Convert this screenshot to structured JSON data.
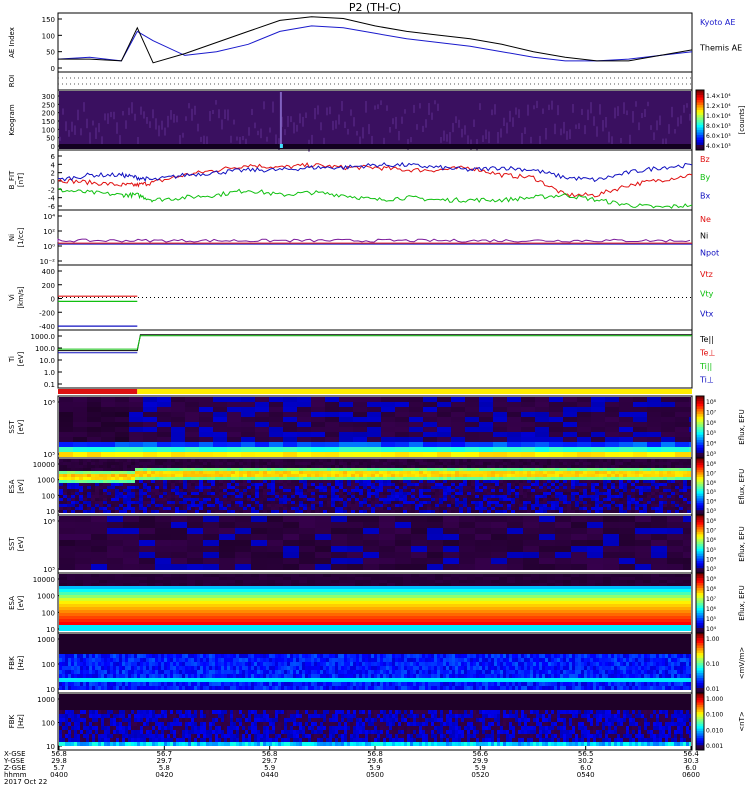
{
  "title": "P2 (TH-C)",
  "colors": {
    "kyoto": "#1a1acc",
    "themis": "#000000",
    "red": "#e01010",
    "green": "#10c010",
    "blue": "#1010c0",
    "purple": "#7a1a9a",
    "bar_red": "#dd1111",
    "bar_yellow": "#ffee00"
  },
  "panels": [
    {
      "key": "ae",
      "ylabel": "AE Index",
      "unit": "",
      "yticks": [
        "150",
        "100",
        "50",
        "0"
      ],
      "legend": [
        {
          "text": "Kyoto AE",
          "color": "#1a1acc"
        },
        {
          "text": "Themis AE",
          "color": "#000000"
        }
      ]
    },
    {
      "key": "roi",
      "ylabel": "ROI",
      "unit": "",
      "yticks": [],
      "legend": []
    },
    {
      "key": "keogram",
      "ylabel": "Keogram",
      "unit": "",
      "yticks": [
        "300",
        "250",
        "200",
        "150",
        "100",
        "50",
        "0"
      ],
      "legend": []
    },
    {
      "key": "bfield",
      "ylabel": "B_FIT",
      "unit": "[nT]",
      "yticks": [
        "6",
        "4",
        "2",
        "0",
        "-2",
        "-4",
        "-6"
      ],
      "legend": [
        {
          "text": "Bz",
          "color": "#e01010"
        },
        {
          "text": "By",
          "color": "#10c010"
        },
        {
          "text": "Bx",
          "color": "#1010c0"
        }
      ]
    },
    {
      "key": "density",
      "ylabel": "Ni",
      "unit": "[1/cc]",
      "yticks": [
        "10⁴",
        "10²",
        "10⁰",
        "10⁻²"
      ],
      "legend": [
        {
          "text": "Ne",
          "color": "#e01010"
        },
        {
          "text": "Ni",
          "color": "#000000"
        },
        {
          "text": "Npot",
          "color": "#1010c0"
        }
      ]
    },
    {
      "key": "velocity",
      "ylabel": "Vi",
      "unit": "[km/s]",
      "yticks": [
        "400",
        "200",
        "0",
        "-200",
        "-400"
      ],
      "legend": [
        {
          "text": "Vtz",
          "color": "#e01010"
        },
        {
          "text": "Vty",
          "color": "#10c010"
        },
        {
          "text": "Vtx",
          "color": "#1010c0"
        }
      ]
    },
    {
      "key": "temperature",
      "ylabel": "Ti",
      "unit": "[eV]",
      "yticks": [
        "1000.0",
        "100.0",
        "10.0",
        "1.0",
        "0.1"
      ],
      "legend": [
        {
          "text": "Te||",
          "color": "#000000"
        },
        {
          "text": "Te⊥",
          "color": "#e01010"
        },
        {
          "text": "Ti||",
          "color": "#10c010"
        },
        {
          "text": "Ti⊥",
          "color": "#1010c0"
        }
      ]
    },
    {
      "key": "sst_ion",
      "ylabel": "SST",
      "unit": "[eV]",
      "yticks": [
        "10⁶",
        "10⁵"
      ],
      "legend": []
    },
    {
      "key": "esa_ion",
      "ylabel": "ESA",
      "unit": "[eV]",
      "yticks": [
        "10000",
        "1000",
        "100",
        "10"
      ],
      "legend": []
    },
    {
      "key": "sst_elec",
      "ylabel": "SST",
      "unit": "[eV]",
      "yticks": [
        "10⁶",
        "10⁵"
      ],
      "legend": []
    },
    {
      "key": "esa_elec",
      "ylabel": "ESA",
      "unit": "[eV]",
      "yticks": [
        "10000",
        "1000",
        "100",
        "10"
      ],
      "legend": []
    },
    {
      "key": "fbk_e",
      "ylabel": "FBK",
      "unit": "[Hz]",
      "yticks": [
        "1000",
        "100",
        "10"
      ],
      "legend": []
    },
    {
      "key": "fbk_b",
      "ylabel": "FBK",
      "unit": "[Hz]",
      "yticks": [
        "1000",
        "100",
        "10"
      ],
      "legend": []
    }
  ],
  "colorbars": [
    {
      "key": "keogram",
      "label": "[counts]",
      "ticks": [
        "1.4×10⁴",
        "1.2×10⁴",
        "1.0×10⁴",
        "8.0×10³",
        "6.0×10³",
        "4.0×10³"
      ]
    },
    {
      "key": "sst_ion",
      "label": "Eflux, EFU",
      "ticks": [
        "10⁸",
        "10⁷",
        "10⁶",
        "10⁵",
        "10⁴",
        "10³"
      ]
    },
    {
      "key": "esa_ion",
      "label": "Eflux, EFU",
      "ticks": [
        "10⁸",
        "10⁷",
        "10⁶",
        "10⁵",
        "10⁴",
        "10³"
      ]
    },
    {
      "key": "sst_elec",
      "label": "Eflux, EFU",
      "ticks": [
        "10⁸",
        "10⁷",
        "10⁶",
        "10⁵",
        "10⁴",
        "10³"
      ]
    },
    {
      "key": "esa_elec",
      "label": "Eflux, EFU",
      "ticks": [
        "10⁹",
        "10⁸",
        "10⁷",
        "10⁶",
        "10⁵",
        "10⁴"
      ]
    },
    {
      "key": "fbk",
      "label": "<mV/m>",
      "ticks": [
        "1.00",
        "0.10",
        "0.01"
      ]
    },
    {
      "key": "fbk2",
      "label": "<nT>",
      "ticks": [
        "1.000",
        "0.100",
        "0.010",
        "0.001"
      ]
    }
  ],
  "time_axis": {
    "row_labels": [
      "X-GSE",
      "Y-GSE",
      "Z-GSE",
      "hhmm",
      "2017 Oct 22"
    ],
    "ticks": [
      {
        "x": "56.8",
        "y": "29.8",
        "z": "5.7",
        "t": "0400"
      },
      {
        "x": "56.7",
        "y": "29.7",
        "z": "5.8",
        "t": "0420"
      },
      {
        "x": "56.8",
        "y": "29.7",
        "z": "5.9",
        "t": "0440"
      },
      {
        "x": "56.8",
        "y": "29.6",
        "z": "5.9",
        "t": "0500"
      },
      {
        "x": "56.6",
        "y": "29.9",
        "z": "5.9",
        "t": "0520"
      },
      {
        "x": "56.5",
        "y": "30.2",
        "z": "6.0",
        "t": "0540"
      },
      {
        "x": "56.4",
        "y": "30.3",
        "z": "6.0",
        "t": "0600"
      }
    ]
  },
  "chart_data": {
    "type": "line",
    "title": "P2 (TH-C)",
    "x_range": [
      "0400",
      "0600"
    ],
    "ae": {
      "ylim": [
        0,
        160
      ],
      "x_hours": [
        4.0,
        4.1,
        4.2,
        4.25,
        4.3,
        4.4,
        4.5,
        4.6,
        4.7,
        4.8,
        4.9,
        5.0,
        5.1,
        5.2,
        5.3,
        5.4,
        5.5,
        5.6,
        5.7,
        5.8,
        5.9,
        6.0
      ],
      "series": [
        {
          "name": "Kyoto AE",
          "values": [
            35,
            40,
            30,
            110,
            85,
            45,
            55,
            75,
            110,
            125,
            120,
            105,
            90,
            80,
            70,
            55,
            40,
            30,
            30,
            35,
            45,
            55
          ]
        },
        {
          "name": "Themis AE",
          "values": [
            35,
            35,
            30,
            120,
            25,
            50,
            80,
            110,
            140,
            150,
            145,
            125,
            110,
            100,
            90,
            75,
            55,
            40,
            30,
            30,
            45,
            60
          ]
        }
      ]
    },
    "bfield": {
      "ylim": [
        -6,
        6
      ],
      "x_hours": [
        4.0,
        4.1,
        4.2,
        4.25,
        4.3,
        4.4,
        4.5,
        4.6,
        4.7,
        4.8,
        4.9,
        5.0,
        5.1,
        5.2,
        5.3,
        5.4,
        5.5,
        5.6,
        5.7,
        5.8,
        5.9,
        6.0
      ],
      "series": [
        {
          "name": "Bz",
          "values": [
            0,
            -0.5,
            -1,
            -1,
            -0.5,
            1,
            2,
            3,
            2.5,
            3,
            2.5,
            2.5,
            2,
            2,
            2.5,
            1,
            0.5,
            -3,
            -3,
            -1,
            0,
            1
          ]
        },
        {
          "name": "By",
          "values": [
            -2,
            -2.5,
            -3,
            -3,
            -4,
            -3.5,
            -3,
            -2,
            -3,
            -2.5,
            -3,
            -4,
            -3.5,
            -4,
            -4,
            -4,
            -3.5,
            -3,
            -4,
            -5,
            -5.5,
            -5
          ]
        },
        {
          "name": "Bx",
          "values": [
            0,
            1,
            1,
            0.5,
            0,
            1,
            1.5,
            2,
            2,
            2.5,
            2.5,
            3,
            3,
            2.5,
            2,
            2.5,
            2,
            0.5,
            0,
            1.5,
            2.5,
            3
          ]
        }
      ]
    },
    "velocity": {
      "ylim": [
        -500,
        500
      ],
      "x_hours": [
        4.0,
        4.25
      ],
      "series": [
        {
          "name": "Vtz",
          "values": [
            20,
            20
          ]
        },
        {
          "name": "Vty",
          "values": [
            -60,
            -60
          ]
        },
        {
          "name": "Vtx",
          "values": [
            -440,
            -440
          ]
        }
      ]
    },
    "temperature": {
      "ylim_log": [
        0.05,
        3000
      ],
      "x_hours": [
        4.0,
        4.25,
        4.26,
        6.0
      ],
      "series": [
        {
          "name": "Te||",
          "values": [
            60,
            60,
            1200,
            1200
          ]
        },
        {
          "name": "Ti||",
          "values": [
            80,
            80,
            1000,
            1000
          ]
        },
        {
          "name": "Ti⊥",
          "values": [
            40,
            40,
            null,
            null
          ]
        }
      ]
    }
  }
}
